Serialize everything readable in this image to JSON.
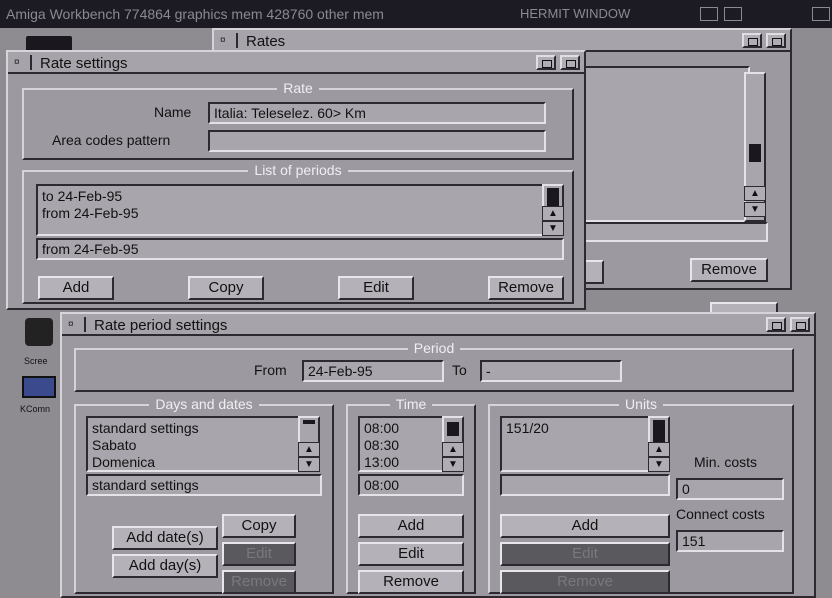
{
  "screen": {
    "title": "Amiga Workbench  774864 graphics mem  428760 other mem",
    "hermit": "HERMIT WINDOW"
  },
  "desktop_icons": {
    "icon1_label": "Scree",
    "icon2_label": "KComn"
  },
  "rates_window": {
    "title": "Rates",
    "remove_button": "Remove"
  },
  "rate_settings": {
    "title": "Rate settings",
    "rate_group": "Rate",
    "name_label": "Name",
    "name_value": "Italia: Teleselez. 60> Km",
    "area_label": "Area codes pattern",
    "area_value": "",
    "periods_group": "List of periods",
    "periods": [
      "to 24-Feb-95",
      "from 24-Feb-95"
    ],
    "selected_period": "from 24-Feb-95",
    "buttons": {
      "add": "Add",
      "copy": "Copy",
      "edit": "Edit",
      "remove": "Remove"
    }
  },
  "period_settings": {
    "title": "Rate period settings",
    "period_group": "Period",
    "from_label": "From",
    "from_value": "24-Feb-95",
    "to_label": "To",
    "to_value": "-",
    "days_group": "Days and dates",
    "days": [
      "standard settings",
      "Sabato",
      "Domenica"
    ],
    "days_selected": "standard settings",
    "days_buttons": {
      "add_dates": "Add date(s)",
      "add_days": "Add day(s)",
      "copy": "Copy",
      "edit": "Edit",
      "remove": "Remove"
    },
    "time_group": "Time",
    "times": [
      "08:00",
      "08:30",
      "13:00"
    ],
    "time_selected": "08:00",
    "time_buttons": {
      "add": "Add",
      "edit": "Edit",
      "remove": "Remove"
    },
    "units_group": "Units",
    "units": [
      "151/20"
    ],
    "units_selected": "",
    "min_costs_label": "Min. costs",
    "min_costs_value": "0",
    "connect_costs_label": "Connect costs",
    "connect_costs_value": "151",
    "units_buttons": {
      "add": "Add",
      "edit": "Edit",
      "remove": "Remove"
    }
  }
}
